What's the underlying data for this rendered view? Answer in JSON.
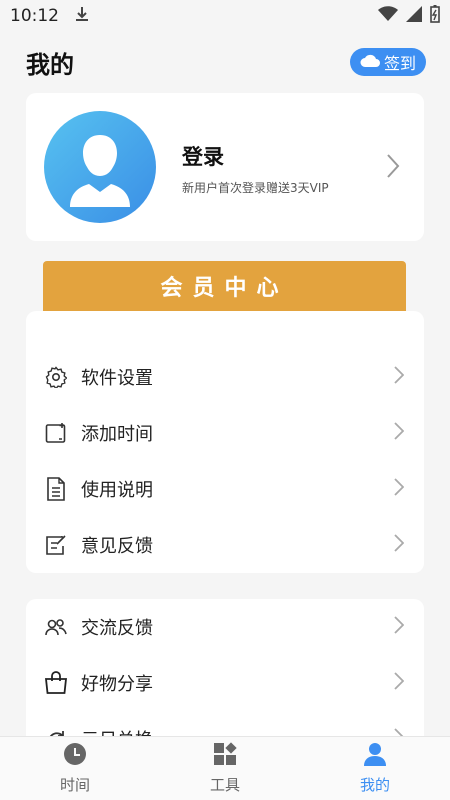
{
  "status_bar": {
    "time": "10:12"
  },
  "header": {
    "title": "我的",
    "checkin_label": "签到"
  },
  "profile": {
    "login_label": "登录",
    "subtitle": "新用户首次登录赠送3天VIP"
  },
  "vip_center": {
    "label": "会员中心"
  },
  "menu_group_1": [
    {
      "label": "软件设置",
      "icon": "gear-icon"
    },
    {
      "label": "添加时间",
      "icon": "add-time-icon"
    },
    {
      "label": "使用说明",
      "icon": "document-icon"
    },
    {
      "label": "意见反馈",
      "icon": "feedback-icon"
    }
  ],
  "menu_group_2": [
    {
      "label": "交流反馈",
      "icon": "people-icon"
    },
    {
      "label": "好物分享",
      "icon": "bag-icon"
    },
    {
      "label": "元日兑换",
      "icon": "exchange-icon"
    }
  ],
  "bottom_nav": [
    {
      "label": "时间",
      "icon": "clock-icon",
      "active": false
    },
    {
      "label": "工具",
      "icon": "tools-icon",
      "active": false
    },
    {
      "label": "我的",
      "icon": "person-icon",
      "active": true
    }
  ],
  "colors": {
    "accent": "#3d8ff2",
    "vip": "#e3a33e",
    "background": "#f5f5f5"
  }
}
